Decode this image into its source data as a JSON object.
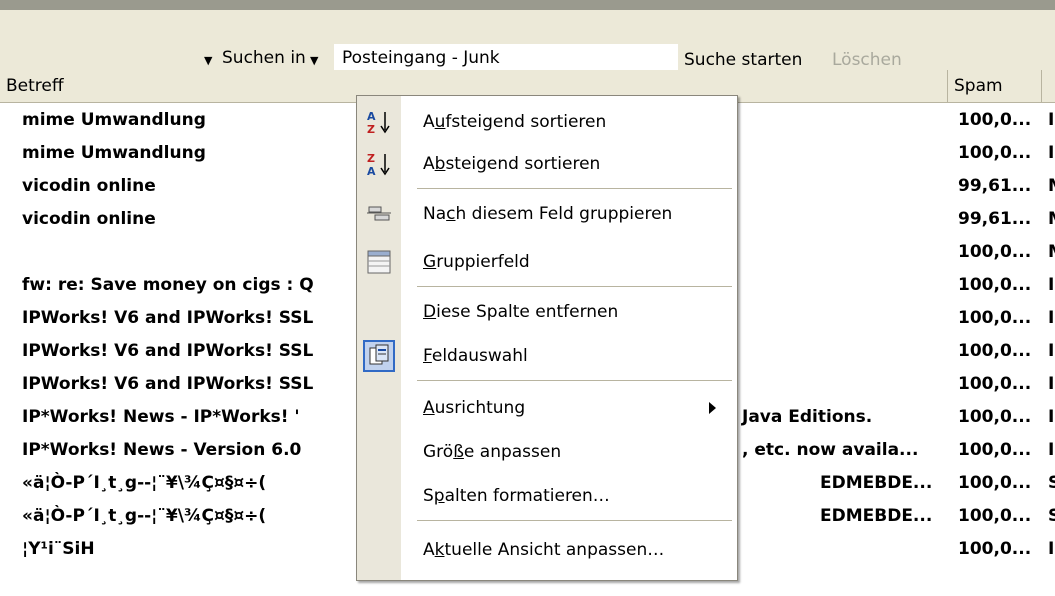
{
  "searchbar": {
    "search_in_label": "Suchen in",
    "search_value": "Posteingang - Junk",
    "start_label": "Suche starten",
    "clear_label": "Löschen"
  },
  "columns": {
    "subject": "Betreff",
    "spam": "Spam"
  },
  "rows": [
    {
      "subject": "mime Umwandlung",
      "extra": "",
      "edm": "",
      "spam": "100,0...",
      "next": "I"
    },
    {
      "subject": "mime Umwandlung",
      "extra": "",
      "edm": "",
      "spam": "100,0...",
      "next": "I"
    },
    {
      "subject": "vicodin online",
      "extra": "",
      "edm": "",
      "spam": "99,61...",
      "next": "M"
    },
    {
      "subject": "vicodin online",
      "extra": "",
      "edm": "",
      "spam": "99,61...",
      "next": "M"
    },
    {
      "subject": "",
      "extra": "",
      "edm": "",
      "spam": "100,0...",
      "next": "M"
    },
    {
      "subject": "fw: re: Save money on cigs : Q",
      "extra": "",
      "edm": "",
      "spam": "100,0...",
      "next": "I"
    },
    {
      "subject": "IPWorks! V6 and IPWorks! SSL",
      "extra": "",
      "edm": "",
      "spam": "100,0...",
      "next": "I"
    },
    {
      "subject": "IPWorks! V6 and IPWorks! SSL",
      "extra": "",
      "edm": "",
      "spam": "100,0...",
      "next": "I"
    },
    {
      "subject": "IPWorks! V6 and IPWorks! SSL",
      "extra": "",
      "edm": "",
      "spam": "100,0...",
      "next": "I"
    },
    {
      "subject": "IP*Works! News  - IP*Works! '",
      "extra": "Java Editions.",
      "edm": "",
      "spam": "100,0...",
      "next": "I"
    },
    {
      "subject": "IP*Works! News  - Version 6.0",
      "extra": ", etc. now availa...",
      "edm": "",
      "spam": "100,0...",
      "next": "I"
    },
    {
      "subject": "«ä¦Ò-P´I¸t¸g--¦¨¥\\¾Ç¤§¤÷(",
      "extra": "",
      "edm": "EDMEBDE...",
      "spam": "100,0...",
      "next": "S"
    },
    {
      "subject": "«ä¦Ò-P´I¸t¸g--¦¨¥\\¾Ç¤§¤÷(",
      "extra": "",
      "edm": "EDMEBDE...",
      "spam": "100,0...",
      "next": "S"
    },
    {
      "subject": "¦Y¹i¨SiH",
      "extra": "",
      "edm": "",
      "spam": "100,0...",
      "next": "I"
    }
  ],
  "menu": {
    "items": [
      {
        "pre": "A",
        "u": "u",
        "post": "fsteigend sortieren",
        "icon": "sort-ascending-icon"
      },
      {
        "pre": "A",
        "u": "b",
        "post": "steigend sortieren",
        "icon": "sort-descending-icon"
      },
      {
        "pre": "Na",
        "u": "c",
        "post": "h diesem Feld gruppieren",
        "icon": "group-by-field-icon"
      },
      {
        "pre": "",
        "u": "G",
        "post": "ruppierfeld",
        "icon": "group-box-icon"
      },
      {
        "pre": "",
        "u": "D",
        "post": "iese Spalte entfernen",
        "icon": ""
      },
      {
        "pre": "",
        "u": "F",
        "post": "eldauswahl",
        "icon": "field-chooser-icon"
      },
      {
        "pre": "",
        "u": "A",
        "post": "usrichtung",
        "icon": ""
      },
      {
        "pre": "Grö",
        "u": "ß",
        "post": "e anpassen",
        "icon": ""
      },
      {
        "pre": "S",
        "u": "p",
        "post": "alten formatieren…",
        "icon": ""
      },
      {
        "pre": "A",
        "u": "k",
        "post": "tuelle Ansicht anpassen…",
        "icon": ""
      }
    ]
  },
  "colors": {
    "toolbar": "#ece9d8",
    "menu_gutter": "#eae7db",
    "selection": "#316ac5"
  }
}
